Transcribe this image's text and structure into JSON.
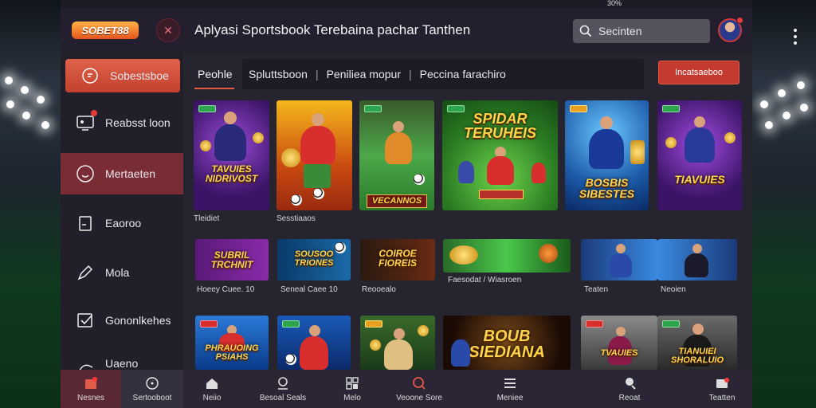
{
  "statusbar": {
    "left": "",
    "right": "30%"
  },
  "header": {
    "logo": "SOBET88",
    "title": "Aplyasi Sportsbook Terebaina pachar Tanthen",
    "search_placeholder": "Secinten"
  },
  "sidebar": {
    "items": [
      {
        "label": "Sobestsboe",
        "icon": "chat-icon"
      },
      {
        "label": "Reabsst loon",
        "icon": "monitor-icon"
      },
      {
        "label": "Mertaeten",
        "icon": "smiley-icon"
      },
      {
        "label": "Eaoroo",
        "icon": "document-icon"
      },
      {
        "label": "Mola",
        "icon": "pen-icon"
      },
      {
        "label": "Gononlkehes",
        "icon": "checkbox-icon"
      },
      {
        "label": "Uaeno",
        "icon": "chart-icon"
      }
    ]
  },
  "main": {
    "tab_label": "Peohle",
    "tabbar": {
      "parts": [
        "Spluttsboon",
        "Peniliea mopur",
        "Peccina farachiro"
      ]
    },
    "primary_button": "Incatsaeboo",
    "row1": [
      {
        "banner": "TAVUIES NIDRIVOST",
        "label": "Tleidiet"
      },
      {
        "banner": "",
        "label": "Sesstiaaos"
      },
      {
        "banner": "VECANNOS",
        "label": ""
      },
      {
        "banner": "SPIDAR TERUHEIS",
        "label": ""
      },
      {
        "banner": "BOSBIS SIBESTES",
        "label": ""
      },
      {
        "banner": "TIAVUIES",
        "label": ""
      }
    ],
    "row2": [
      {
        "banner": "SUBRIL TRCHNIT",
        "label": "Hoeey Cuee. 10"
      },
      {
        "banner": "SOUSOO TRIONES",
        "label": "Seneal Caee 10"
      },
      {
        "banner": "COIROE FIOREIS",
        "label": "Reooealo"
      },
      {
        "banner": "",
        "label": "Faesodat / Wiasroen"
      },
      {
        "banner": "",
        "label": "Teaten"
      },
      {
        "banner": "",
        "label": "Neoien"
      }
    ],
    "row3": [
      {
        "banner": "PHRAUOING PSIAHS"
      },
      {
        "banner": ""
      },
      {
        "banner": ""
      },
      {
        "banner": "BOUB SIEDIANA"
      },
      {
        "banner": "TVAUIES"
      },
      {
        "banner": "TIANUIEI SHORALUIO"
      }
    ]
  },
  "bottomnav": {
    "items": [
      {
        "label": "Nesnes",
        "icon": "calendar-icon"
      },
      {
        "label": "Sertooboot",
        "icon": "clock-icon"
      },
      {
        "label": "Neiio",
        "icon": "home-icon"
      },
      {
        "label": "Besoal Seals",
        "icon": "group-icon"
      },
      {
        "label": "Melo",
        "icon": "grid-icon"
      },
      {
        "label": "Veoone Sore",
        "icon": "search-icon"
      },
      {
        "label": "Meniee",
        "icon": "list-icon"
      },
      {
        "label": "Reoat",
        "icon": "user-icon"
      },
      {
        "label": "Teatten",
        "icon": "inbox-icon"
      }
    ]
  },
  "colors": {
    "accent": "#d4493a",
    "sidebar_active": "#7a2c34",
    "panel": "#26242e"
  }
}
